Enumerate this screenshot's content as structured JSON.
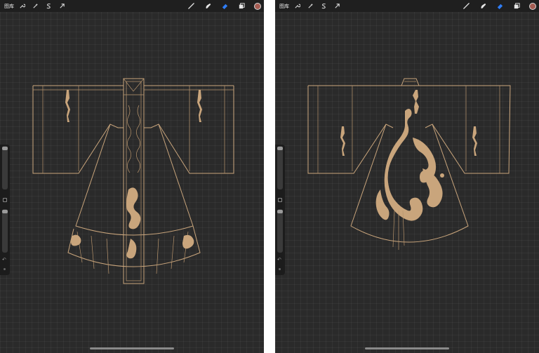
{
  "panels": [
    {
      "id": "left",
      "toolbar": {
        "gallery_label": "图库",
        "left_tools": [
          "wrench-icon",
          "magic-wand-icon",
          "selection-s-icon",
          "transform-arrow-icon"
        ],
        "right_tools": [
          "brush-icon",
          "smudge-icon",
          "eraser-icon",
          "layers-icon"
        ],
        "active_tool": "eraser-icon",
        "color_swatch": "#a55c52",
        "accent_color": "#2f7df6"
      },
      "sidebar": {
        "brush_size": 0.05,
        "opacity": 0.05
      }
    },
    {
      "id": "right",
      "toolbar": {
        "gallery_label": "图库",
        "left_tools": [
          "wrench-icon",
          "magic-wand-icon",
          "selection-s-icon",
          "transform-arrow-icon"
        ],
        "right_tools": [
          "brush-icon",
          "smudge-icon",
          "eraser-icon",
          "layers-icon"
        ],
        "active_tool": "eraser-icon",
        "color_swatch": "#a55c52",
        "accent_color": "#2f7df6"
      },
      "sidebar": {
        "brush_size": 0.05,
        "opacity": 0.05
      }
    }
  ],
  "canvas": {
    "background": "#2a2a2a",
    "line_color": "#c9a57c"
  }
}
